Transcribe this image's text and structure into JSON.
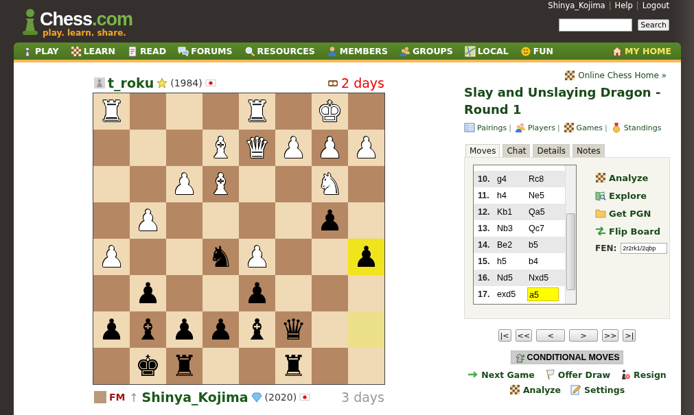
{
  "header": {
    "logo": {
      "brand": "Chess",
      "domain": ".com",
      "tagline": "play. learn. share."
    },
    "user_links": [
      "Shinya_Kojima",
      "Help",
      "Logout"
    ],
    "separator": "|",
    "search_button": "Search"
  },
  "nav": [
    {
      "label": "PLAY",
      "selected": false
    },
    {
      "label": "LEARN",
      "selected": false
    },
    {
      "label": "READ",
      "selected": false
    },
    {
      "label": "FORUMS",
      "selected": false
    },
    {
      "label": "RESOURCES",
      "selected": false
    },
    {
      "label": "MEMBERS",
      "selected": false
    },
    {
      "label": "GROUPS",
      "selected": false
    },
    {
      "label": "LOCAL",
      "selected": false
    },
    {
      "label": "FUN",
      "selected": false
    },
    {
      "label": "MY HOME",
      "selected": true
    }
  ],
  "top_player": {
    "name": "t_roku",
    "rating": "(1984)",
    "clock": "2 days",
    "running": true
  },
  "board": {
    "rows": [
      [
        {
          "piece": "♜",
          "white": true,
          "highlighted": false
        },
        {
          "highlighted": false
        },
        {
          "highlighted": false
        },
        {
          "highlighted": false
        },
        {
          "piece": "♜",
          "white": true,
          "highlighted": false
        },
        {
          "highlighted": false
        },
        {
          "piece": "♚",
          "white": true,
          "highlighted": false
        },
        {
          "highlighted": false
        }
      ],
      [
        {
          "highlighted": false
        },
        {
          "highlighted": false
        },
        {
          "highlighted": false
        },
        {
          "piece": "♝",
          "white": true,
          "highlighted": false
        },
        {
          "piece": "♛",
          "white": true,
          "highlighted": false
        },
        {
          "piece": "♟",
          "white": true,
          "highlighted": false
        },
        {
          "piece": "♟",
          "white": true,
          "highlighted": false
        },
        {
          "piece": "♟",
          "white": true,
          "highlighted": false
        }
      ],
      [
        {
          "highlighted": false
        },
        {
          "highlighted": false
        },
        {
          "piece": "♟",
          "white": true,
          "highlighted": false
        },
        {
          "piece": "♝",
          "white": true,
          "highlighted": false
        },
        {
          "highlighted": false
        },
        {
          "highlighted": false
        },
        {
          "piece": "♞",
          "white": true,
          "highlighted": false
        },
        {
          "highlighted": false
        }
      ],
      [
        {
          "highlighted": false
        },
        {
          "piece": "♟",
          "white": true,
          "highlighted": false
        },
        {
          "highlighted": false
        },
        {
          "highlighted": false
        },
        {
          "highlighted": false
        },
        {
          "highlighted": false
        },
        {
          "piece": "♟",
          "white": false,
          "highlighted": false
        },
        {
          "highlighted": false
        }
      ],
      [
        {
          "piece": "♟",
          "white": true,
          "highlighted": false
        },
        {
          "highlighted": false
        },
        {
          "highlighted": false
        },
        {
          "piece": "♞",
          "white": false,
          "highlighted": false
        },
        {
          "piece": "♟",
          "white": true,
          "highlighted": false
        },
        {
          "highlighted": false
        },
        {
          "highlighted": false
        },
        {
          "piece": "♟",
          "white": false,
          "highlighted": true
        }
      ],
      [
        {
          "highlighted": false
        },
        {
          "piece": "♟",
          "white": false,
          "highlighted": false
        },
        {
          "highlighted": false
        },
        {
          "highlighted": false
        },
        {
          "piece": "♟",
          "white": false,
          "highlighted": false
        },
        {
          "highlighted": false
        },
        {
          "highlighted": false
        },
        {
          "highlighted": false
        }
      ],
      [
        {
          "piece": "♟",
          "white": false,
          "highlighted": false
        },
        {
          "piece": "♝",
          "white": false,
          "highlighted": false
        },
        {
          "piece": "♟",
          "white": false,
          "highlighted": false
        },
        {
          "piece": "♟",
          "white": false,
          "highlighted": false
        },
        {
          "piece": "♝",
          "white": false,
          "highlighted": false
        },
        {
          "piece": "♛",
          "white": false,
          "highlighted": false
        },
        {
          "highlighted": false
        },
        {
          "highlighted": true
        }
      ],
      [
        {
          "highlighted": false
        },
        {
          "piece": "♚",
          "white": false,
          "highlighted": false
        },
        {
          "piece": "♜",
          "white": false,
          "highlighted": false
        },
        {
          "highlighted": false
        },
        {
          "highlighted": false
        },
        {
          "piece": "♜",
          "white": false,
          "highlighted": false
        },
        {
          "highlighted": false
        },
        {
          "highlighted": false
        }
      ]
    ]
  },
  "bottom_player": {
    "title": "FM",
    "name": "Shinya_Kojima",
    "rating": "(2020)",
    "clock": "3 days",
    "running": false
  },
  "sidebar": {
    "home_link": "Online Chess Home »",
    "title": "Slay and Unslaying Dragon - Round 1",
    "links": [
      {
        "label": "Pairings",
        "separator": "|"
      },
      {
        "label": "Players",
        "separator": "|"
      },
      {
        "label": "Games",
        "separator": "|"
      },
      {
        "label": "Standings"
      }
    ],
    "tabs": [
      {
        "label": "Moves",
        "selected": true
      },
      {
        "label": "Chat",
        "selected": false
      },
      {
        "label": "Details",
        "selected": false
      },
      {
        "label": "Notes",
        "selected": false
      }
    ],
    "moves": [
      {
        "number": "10.",
        "white": {
          "san": "g4",
          "current": false
        },
        "black": {
          "san": "Rc8",
          "current": false
        }
      },
      {
        "number": "11.",
        "white": {
          "san": "h4",
          "current": false
        },
        "black": {
          "san": "Ne5",
          "current": false
        }
      },
      {
        "number": "12.",
        "white": {
          "san": "Kb1",
          "current": false
        },
        "black": {
          "san": "Qa5",
          "current": false
        }
      },
      {
        "number": "13.",
        "white": {
          "san": "Nb3",
          "current": false
        },
        "black": {
          "san": "Qc7",
          "current": false
        }
      },
      {
        "number": "14.",
        "white": {
          "san": "Be2",
          "current": false
        },
        "black": {
          "san": "b5",
          "current": false
        }
      },
      {
        "number": "15.",
        "white": {
          "san": "h5",
          "current": false
        },
        "black": {
          "san": "b4",
          "current": false
        }
      },
      {
        "number": "16.",
        "white": {
          "san": "Nd5",
          "current": false
        },
        "black": {
          "san": "Nxd5",
          "current": false
        }
      },
      {
        "number": "17.",
        "white": {
          "san": "exd5",
          "current": false
        },
        "black": {
          "san": "a5",
          "current": true
        }
      }
    ],
    "actions": [
      "Analyze",
      "Explore",
      "Get PGN",
      "Flip Board"
    ],
    "fen": {
      "label": "FEN:",
      "value": "2r2rk1/2qbp"
    },
    "nav_buttons": [
      "|<",
      "<<",
      "<",
      ">",
      ">>",
      ">|"
    ],
    "conditional_button": "CONDITIONAL MOVES",
    "game_actions": [
      [
        "Next Game",
        "Offer Draw",
        "Resign"
      ],
      [
        "Analyze",
        "Settings"
      ]
    ]
  }
}
